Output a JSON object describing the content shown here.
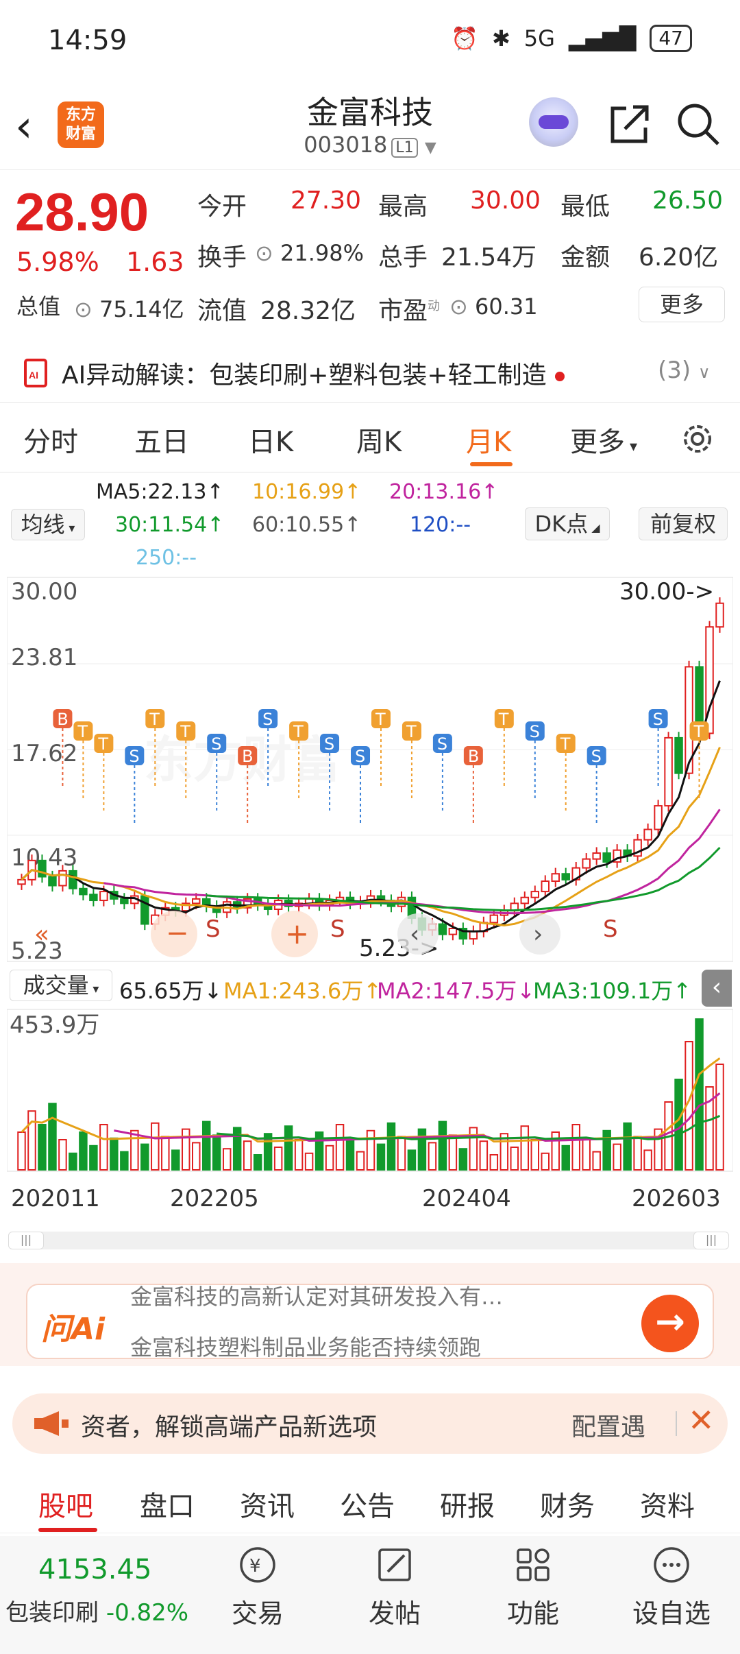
{
  "status_bar": {
    "time": "14:59",
    "network": "5G",
    "battery": "47"
  },
  "header": {
    "logo_text": "东方\n财富",
    "stock_name": "金富科技",
    "stock_code": "003018",
    "level": "L1"
  },
  "quote": {
    "price": "28.90",
    "change_pct": "5.98%",
    "change": "1.63",
    "open_label": "今开",
    "open": "27.30",
    "high_label": "最高",
    "high": "30.00",
    "low_label": "最低",
    "low": "26.50",
    "turnover_label": "换手",
    "turnover": "21.98%",
    "volume_label": "总手",
    "volume": "21.54万",
    "amount_label": "金额",
    "amount": "6.20亿",
    "mktcap_label": "总值",
    "mktcap": "75.14亿",
    "float_label": "流值",
    "float_cap": "28.32亿",
    "pe_label": "市盈",
    "pe_sup": "动",
    "pe": "60.31",
    "more_button": "更多"
  },
  "ai_strip": {
    "text": "AI异动解读：包装印刷+塑料包装+轻工制造",
    "count": "(3)"
  },
  "tabs": [
    "分时",
    "五日",
    "日K",
    "周K",
    "月K",
    "更多"
  ],
  "active_tab": "月K",
  "ma_row": {
    "indicator_select": "均线",
    "ma5": "MA5:22.13↑",
    "ma10": "10:16.99↑",
    "ma20": "20:13.16↑",
    "ma30": "30:11.54↑",
    "ma60": "60:10.55↑",
    "ma120": "120:--",
    "ma250": "250:--",
    "dk_button": "DK点",
    "adjust_button": "前复权"
  },
  "kchart": {
    "y_labels": [
      "30.00",
      "23.81",
      "17.62",
      "10.43",
      "5.23"
    ],
    "high_marker": "30.00->",
    "low_marker": "5.23->",
    "watermark": "东方财富",
    "zoom_out": "−",
    "zoom_in": "+",
    "s_label": "S"
  },
  "volume": {
    "indicator_select": "成交量",
    "vol": "65.65万↓",
    "ma1": "MA1:243.6万↑",
    "ma2": "MA2:147.5万↓",
    "ma3": "MA3:109.1万↑",
    "y_max": "453.9万"
  },
  "dates": [
    "202011",
    "202205",
    "202404",
    "202603"
  ],
  "ask_ai": {
    "logo": "问Ai",
    "line1": "金富科技的高新认定对其研发投入有…",
    "line2": "金富科技塑料制品业务能否持续领跑"
  },
  "banner": {
    "text": "资者，解锁高端产品新选项",
    "config": "配置遇"
  },
  "subtabs": [
    "股吧",
    "盘口",
    "资讯",
    "公告",
    "研报",
    "财务",
    "资料"
  ],
  "bottom_bar": {
    "index_value": "4153.45",
    "index_name": "包装印刷",
    "index_change": "-0.82%",
    "items": [
      "交易",
      "发帖",
      "功能",
      "设自选"
    ]
  },
  "colors": {
    "up": "#e02020",
    "down": "#119a2c",
    "accent": "#f26a1b"
  },
  "chart_data": {
    "type": "candlestick",
    "y_axis_labels": [
      "30.00",
      "23.81",
      "17.62",
      "10.43",
      "5.23"
    ],
    "x_tick_labels": [
      "202011",
      "202205",
      "202404",
      "202603"
    ],
    "last_price": 28.9,
    "period_high": 30.0,
    "period_low": 5.23,
    "volume_axis_max_label": "453.9万",
    "legend": [
      "MA5",
      "10",
      "20",
      "30",
      "60",
      "120",
      "250"
    ]
  }
}
